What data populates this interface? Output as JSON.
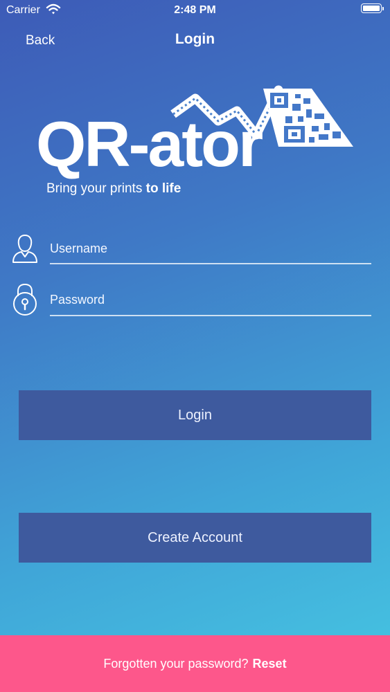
{
  "status_bar": {
    "carrier": "Carrier",
    "time": "2:48 PM"
  },
  "nav": {
    "back_label": "Back",
    "title": "Login"
  },
  "logo": {
    "text": "QR-ator",
    "tagline_prefix": "Bring your prints ",
    "tagline_bold": "to life"
  },
  "form": {
    "username_placeholder": "Username",
    "password_placeholder": "Password"
  },
  "buttons": {
    "login_label": "Login",
    "create_account_label": "Create Account"
  },
  "footer": {
    "forgot_text": "Forgotten your password?",
    "reset_label": "Reset"
  },
  "colors": {
    "gradient_top": "#3d5bb7",
    "gradient_bottom": "#46c6e2",
    "button_bg": "#3e5a9e",
    "footer_bg": "#fd578b"
  }
}
